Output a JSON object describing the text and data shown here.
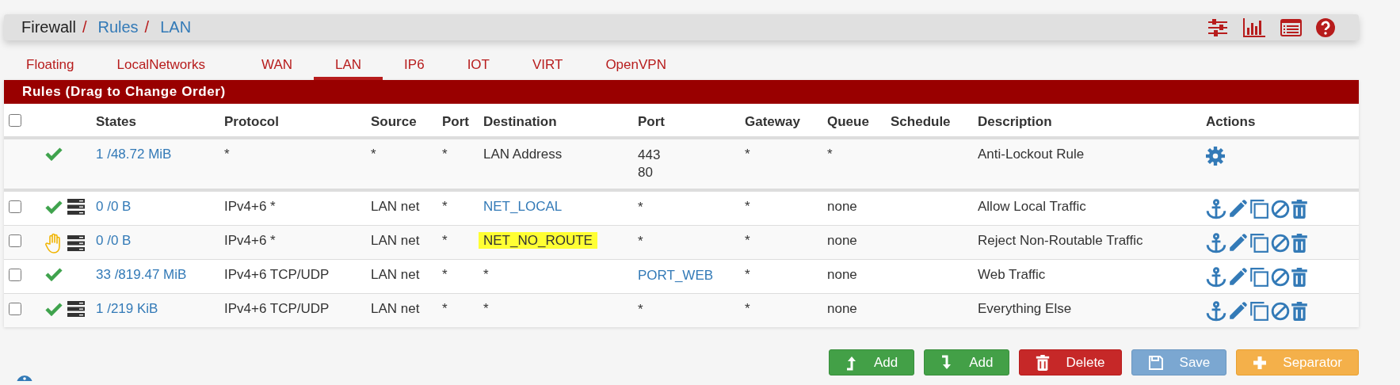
{
  "breadcrumb": [
    {
      "label": "Firewall",
      "link": false,
      "separator": "/"
    },
    {
      "label": "Rules",
      "link": true,
      "separator": "/"
    },
    {
      "label": "LAN",
      "link": true
    }
  ],
  "tabs": [
    {
      "label": "Floating",
      "selected": false
    },
    {
      "label": "LocalNetworks",
      "selected": false
    },
    {
      "label": "WAN",
      "selected": false
    },
    {
      "label": "LAN",
      "selected": true
    },
    {
      "label": "IP6",
      "selected": false
    },
    {
      "label": "IOT",
      "selected": false
    },
    {
      "label": "VIRT",
      "selected": false
    },
    {
      "label": "OpenVPN",
      "selected": false
    }
  ],
  "panel": {
    "title": "Rules (Drag to Change Order)"
  },
  "table": {
    "select_all_checked": false,
    "columns": [
      "States",
      "Protocol",
      "Source",
      "Port",
      "Destination",
      "Port",
      "Gateway",
      "Queue",
      "Schedule",
      "Description",
      "Actions"
    ],
    "rows": [
      {
        "kind": "fixed",
        "rejected": false,
        "logged": false,
        "states": "1 /48.72 MiB",
        "protocol": "*",
        "source": "*",
        "port": "*",
        "destination": "LAN Address",
        "destination_link": false,
        "destination_highlighted": false,
        "dest_port": [
          "443",
          "80"
        ],
        "dest_port_link": false,
        "gateway": "*",
        "queue": "*",
        "description": "Anti-Lockout Rule"
      },
      {
        "kind": "rule",
        "checked": false,
        "rejected": false,
        "logged": true,
        "states": "0 /0 B",
        "protocol": "IPv4+6 *",
        "source": "LAN net",
        "port": "*",
        "destination": "NET_LOCAL",
        "destination_link": true,
        "destination_highlighted": false,
        "dest_port": [
          "*"
        ],
        "dest_port_link": false,
        "gateway": "*",
        "queue": "none",
        "description": "Allow Local Traffic"
      },
      {
        "kind": "rule",
        "checked": false,
        "rejected": true,
        "logged": true,
        "states": "0 /0 B",
        "protocol": "IPv4+6 *",
        "source": "LAN net",
        "port": "*",
        "destination": "NET_NO_ROUTE",
        "destination_link": false,
        "destination_highlighted": true,
        "dest_port": [
          "*"
        ],
        "dest_port_link": false,
        "gateway": "*",
        "queue": "none",
        "description": "Reject Non-Routable Traffic"
      },
      {
        "kind": "rule",
        "checked": false,
        "rejected": false,
        "logged": false,
        "states": "33 /819.47 MiB",
        "protocol": "IPv4+6 TCP/UDP",
        "source": "LAN net",
        "port": "*",
        "destination": "*",
        "destination_link": false,
        "destination_highlighted": false,
        "dest_port": [
          "PORT_WEB"
        ],
        "dest_port_link": true,
        "gateway": "*",
        "queue": "none",
        "description": "Web Traffic"
      },
      {
        "kind": "rule",
        "checked": false,
        "rejected": false,
        "logged": true,
        "states": "1 /219 KiB",
        "protocol": "IPv4+6 TCP/UDP",
        "source": "LAN net",
        "port": "*",
        "destination": "*",
        "destination_link": false,
        "destination_highlighted": false,
        "dest_port": [
          "*"
        ],
        "dest_port_link": false,
        "gateway": "*",
        "queue": "none",
        "description": "Everything Else"
      }
    ]
  },
  "buttons": [
    {
      "kind": "add_top",
      "label": "Add"
    },
    {
      "kind": "add_bottom",
      "label": "Add"
    },
    {
      "kind": "delete",
      "label": "Delete"
    },
    {
      "kind": "save",
      "label": "Save"
    },
    {
      "kind": "separator",
      "label": "Separator"
    }
  ]
}
